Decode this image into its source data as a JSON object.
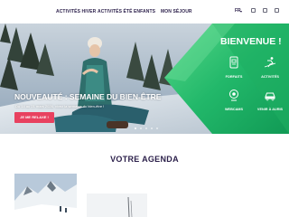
{
  "nav": {
    "items": [
      "ACTIVITÉS HIVER",
      "ACTIVITÉS ÉTÉ",
      "ENFANTS",
      "MON SÉJOUR"
    ],
    "lang": "FR"
  },
  "hero": {
    "title": "NOUVEAUTÉ : SEMAINE DU BIEN-ÊTRE",
    "subtitle": "Du 14 au 21 mars 2026, vivez la semaine du bien-être !",
    "button": "JE ME RELAXE !",
    "slide_count": 5,
    "active_slide": 1
  },
  "welcome": {
    "title": "BIENVENUE !",
    "tiles": [
      {
        "label": "FORFAITS",
        "icon": "ski-pass-icon"
      },
      {
        "label": "ACTIVITÉS",
        "icon": "skier-icon"
      },
      {
        "label": "WEBCAMS",
        "icon": "webcam-icon"
      },
      {
        "label": "VENIR À AURIS",
        "icon": "car-icon"
      }
    ]
  },
  "agenda": {
    "title": "VOTRE AGENDA"
  },
  "colors": {
    "brand_dark": "#2b1f4a",
    "accent_green": "#25c76f",
    "accent_pink": "#e8415f"
  }
}
